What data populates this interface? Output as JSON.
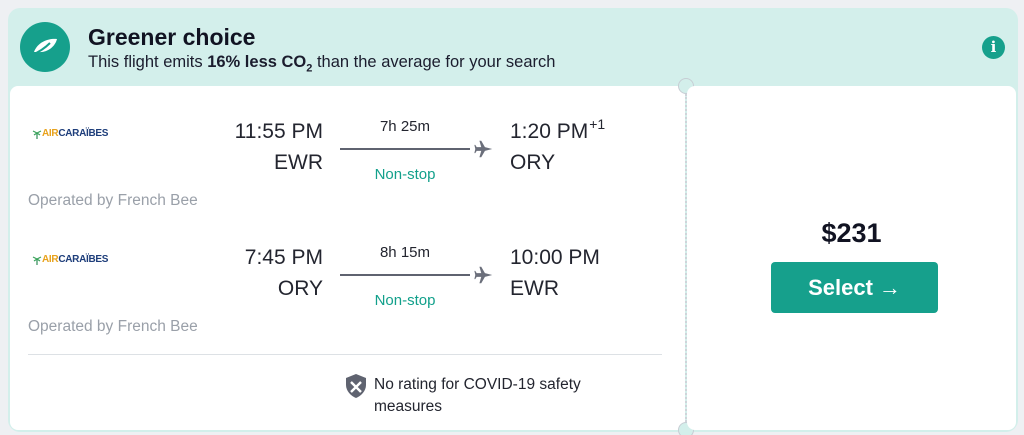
{
  "banner": {
    "title": "Greener choice",
    "sub_prefix": "This flight emits ",
    "sub_bold": "16% less CO",
    "sub_subscript": "2",
    "sub_suffix": " than the average for your search",
    "info_glyph": "i",
    "icon": "leaf-icon",
    "accent_color": "#16a08c",
    "background_color": "#d3efeb"
  },
  "legs": [
    {
      "airline_logo_text_a": "AIR",
      "airline_logo_text_b": "CARAÏBES",
      "dep_time": "11:55 PM",
      "dep_code": "EWR",
      "duration": "7h 25m",
      "stops": "Non-stop",
      "arr_time": "1:20 PM",
      "arr_dayoffset": "+1",
      "arr_code": "ORY",
      "operated_by": "Operated by French Bee"
    },
    {
      "airline_logo_text_a": "AIR",
      "airline_logo_text_b": "CARAÏBES",
      "dep_time": "7:45 PM",
      "dep_code": "ORY",
      "duration": "8h 15m",
      "stops": "Non-stop",
      "arr_time": "10:00 PM",
      "arr_dayoffset": "",
      "arr_code": "EWR",
      "operated_by": "Operated by French Bee"
    }
  ],
  "covid": {
    "text": "No rating for COVID-19 safety measures",
    "icon": "shield-icon"
  },
  "offer": {
    "price": "$231",
    "select_label": "Select",
    "select_arrow": "→"
  }
}
